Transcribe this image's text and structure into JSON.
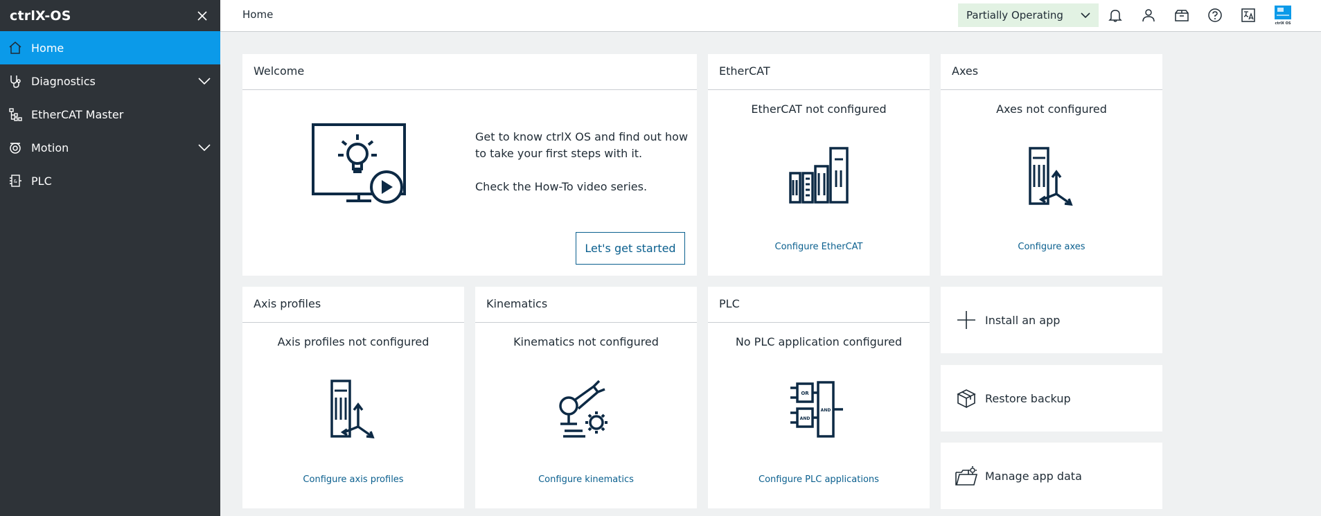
{
  "app": {
    "title": "ctrlX-OS"
  },
  "sidebar": {
    "items": [
      {
        "label": "Home",
        "icon": "home-icon",
        "active": true
      },
      {
        "label": "Diagnostics",
        "icon": "stethoscope-icon",
        "expandable": true
      },
      {
        "label": "EtherCAT Master",
        "icon": "network-tree-icon"
      },
      {
        "label": "Motion",
        "icon": "motion-icon",
        "expandable": true
      },
      {
        "label": "PLC",
        "icon": "plc-icon"
      }
    ]
  },
  "topbar": {
    "breadcrumb": "Home",
    "status": "Partially Operating",
    "icons": [
      "bell-icon",
      "user-icon",
      "package-icon",
      "help-icon",
      "language-icon",
      "ctrlx-os-logo"
    ]
  },
  "colors": {
    "accent": "#0b9ae9",
    "sidebar_bg": "#2e3338",
    "status_bg": "#e2f2e3",
    "link": "#0a5f8e",
    "icon": "#0d2a45"
  },
  "cards": {
    "welcome": {
      "title": "Welcome",
      "text1": "Get to know ctrlX OS and find out how to take your first steps with it.",
      "text2": "Check the How-To video series.",
      "button": "Let's get started"
    },
    "ethercat": {
      "title": "EtherCAT",
      "status": "EtherCAT not configured",
      "link": "Configure EtherCAT"
    },
    "axes": {
      "title": "Axes",
      "status": "Axes not configured",
      "link": "Configure axes"
    },
    "axis_profiles": {
      "title": "Axis profiles",
      "status": "Axis profiles not configured",
      "link": "Configure axis profiles"
    },
    "kinematics": {
      "title": "Kinematics",
      "status": "Kinematics not configured",
      "link": "Configure kinematics"
    },
    "plc": {
      "title": "PLC",
      "status": "No PLC application configured",
      "link": "Configure PLC applications",
      "icon_labels": [
        "OR",
        "AND",
        "AND"
      ]
    }
  },
  "actions": [
    {
      "label": "Install an app",
      "icon": "plus-icon"
    },
    {
      "label": "Restore backup",
      "icon": "box-icon"
    },
    {
      "label": "Manage app data",
      "icon": "folder-gear-icon"
    }
  ]
}
